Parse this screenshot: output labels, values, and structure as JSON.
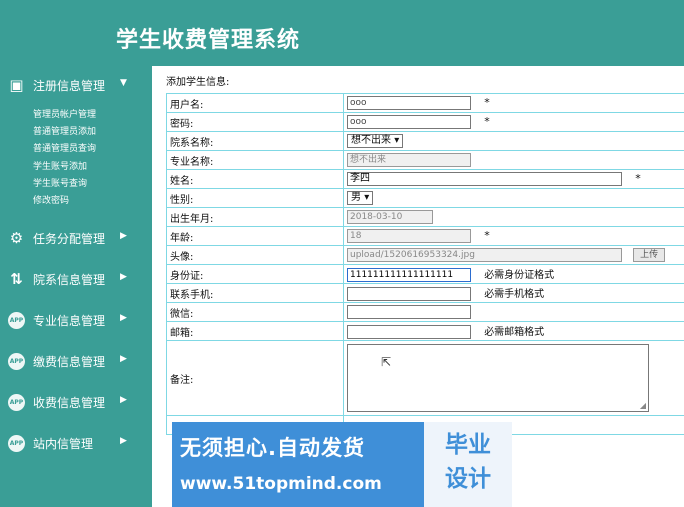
{
  "app": {
    "title": "学生收费管理系统"
  },
  "sidebar": {
    "sections": [
      {
        "label": "注册信息管理",
        "icon": "monitor-icon",
        "expanded": true,
        "children": [
          "管理员帐户管理",
          "普通管理员添加",
          "普通管理员查询",
          "学生账号添加",
          "学生账号查询",
          "修改密码"
        ]
      },
      {
        "label": "任务分配管理",
        "icon": "user-gear-icon"
      },
      {
        "label": "院系信息管理",
        "icon": "swap-icon"
      },
      {
        "label": "专业信息管理",
        "icon": "app-icon"
      },
      {
        "label": "缴费信息管理",
        "icon": "app-icon"
      },
      {
        "label": "收费信息管理",
        "icon": "app-icon"
      },
      {
        "label": "站内信管理",
        "icon": "app-icon"
      }
    ],
    "app_icon_text": "APP"
  },
  "form": {
    "caption": "添加学生信息:",
    "required_mark": "*",
    "rows": {
      "username": {
        "label": "用户名:",
        "value": "ooo"
      },
      "password": {
        "label": "密码:",
        "value": "ooo"
      },
      "department": {
        "label": "院系名称:",
        "selected": "想不出来"
      },
      "major": {
        "label": "专业名称:",
        "value": "想不出来"
      },
      "name": {
        "label": "姓名:",
        "value": "李四"
      },
      "gender": {
        "label": "性别:",
        "selected": "男"
      },
      "birth": {
        "label": "出生年月:",
        "value": "2018-03-10"
      },
      "age": {
        "label": "年龄:",
        "value": "18"
      },
      "avatar": {
        "label": "头像:",
        "value": "upload/1520616953324.jpg",
        "button": "上传"
      },
      "id_card": {
        "label": "身份证:",
        "value": "111111111111111111",
        "hint": "必需身份证格式"
      },
      "phone": {
        "label": "联系手机:",
        "value": "",
        "hint": "必需手机格式"
      },
      "wechat": {
        "label": "微信:",
        "value": ""
      },
      "email": {
        "label": "邮箱:",
        "value": "",
        "hint": "必需邮箱格式"
      },
      "remark": {
        "label": "备注:",
        "value": ""
      }
    }
  },
  "watermark": {
    "line1": "无须担心.自动发货",
    "line2": "www.51topmind.com",
    "badge_line1": "毕业",
    "badge_line2": "设计"
  }
}
